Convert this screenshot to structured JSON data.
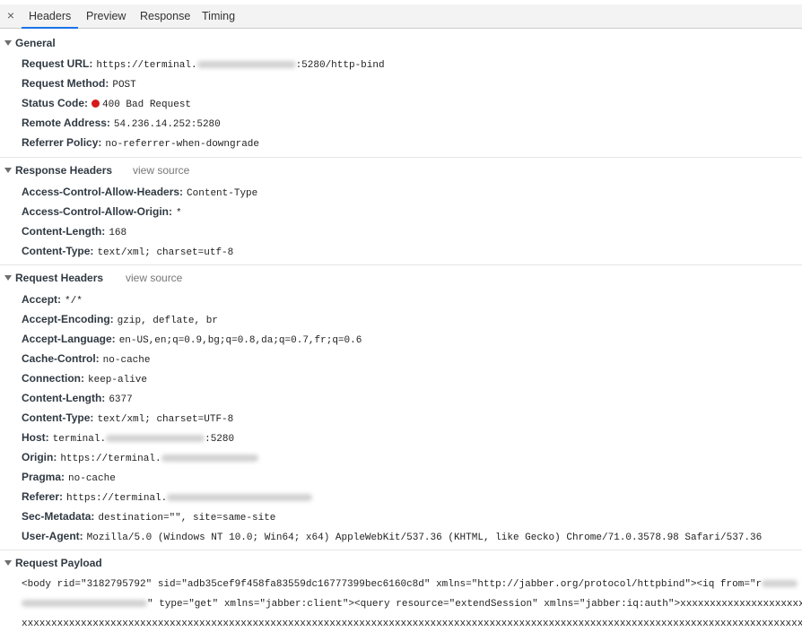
{
  "tabs": [
    {
      "label": "Headers",
      "active": true
    },
    {
      "label": "Preview",
      "active": false
    },
    {
      "label": "Response",
      "active": false
    },
    {
      "label": "Timing",
      "active": false
    }
  ],
  "close_glyph": "×",
  "general": {
    "title": "General",
    "request_url": {
      "key": "Request URL:",
      "prefix": "https://terminal.",
      "suffix": ":5280/http-bind"
    },
    "request_method": {
      "key": "Request Method:",
      "value": "POST"
    },
    "status_code": {
      "key": "Status Code:",
      "value": "400 Bad Request",
      "status_color": "#d61a1a"
    },
    "remote_address": {
      "key": "Remote Address:",
      "value": "54.236.14.252:5280"
    },
    "referrer_policy": {
      "key": "Referrer Policy:",
      "value": "no-referrer-when-downgrade"
    }
  },
  "response_headers": {
    "title": "Response Headers",
    "view_source": "view source",
    "items": [
      {
        "key": "Access-Control-Allow-Headers:",
        "value": "Content-Type"
      },
      {
        "key": "Access-Control-Allow-Origin:",
        "value": "*"
      },
      {
        "key": "Content-Length:",
        "value": "168"
      },
      {
        "key": "Content-Type:",
        "value": "text/xml; charset=utf-8"
      }
    ]
  },
  "request_headers": {
    "title": "Request Headers",
    "view_source": "view source",
    "items": [
      {
        "key": "Accept:",
        "value": "*/*"
      },
      {
        "key": "Accept-Encoding:",
        "value": "gzip, deflate, br"
      },
      {
        "key": "Accept-Language:",
        "value": "en-US,en;q=0.9,bg;q=0.8,da;q=0.7,fr;q=0.6"
      },
      {
        "key": "Cache-Control:",
        "value": "no-cache"
      },
      {
        "key": "Connection:",
        "value": "keep-alive"
      },
      {
        "key": "Content-Length:",
        "value": "6377"
      },
      {
        "key": "Content-Type:",
        "value": "text/xml; charset=UTF-8"
      },
      {
        "key": "Host:",
        "value": "terminal.",
        "suffix": ":5280"
      },
      {
        "key": "Origin:",
        "value": "https://terminal."
      },
      {
        "key": "Pragma:",
        "value": "no-cache"
      },
      {
        "key": "Referer:",
        "value": "https://terminal."
      },
      {
        "key": "Sec-Metadata:",
        "value": "destination=\"\", site=same-site"
      },
      {
        "key": "User-Agent:",
        "value": "Mozilla/5.0 (Windows NT 10.0; Win64; x64) AppleWebKit/537.36 (KHTML, like Gecko) Chrome/71.0.3578.98 Safari/537.36"
      }
    ]
  },
  "request_payload": {
    "title": "Request Payload",
    "line1": "<body rid=\"3182795792\" sid=\"adb35cef9f458fa83559dc16777399bec6160c8d\" xmlns=\"http://jabber.org/protocol/httpbind\"><iq from=\"r",
    "line2": "\" type=\"get\" xmlns=\"jabber:client\"><query resource=\"extendSession\" xmlns=\"jabber:iq:auth\">xxxxxxxxxxxxxxxxxxxxx",
    "line3": "xxxxxxxxxxxxxxxxxxxxxxxxxxxxxxxxxxxxxxxxxxxxxxxxxxxxxxxxxxxxxxxxxxxxxxxxxxxxxxxxxxxxxxxxxxxxxxxxxxxxxxxxxxxxxxxxxxxxxxxxxxxxxxxxxxxxxx"
  }
}
